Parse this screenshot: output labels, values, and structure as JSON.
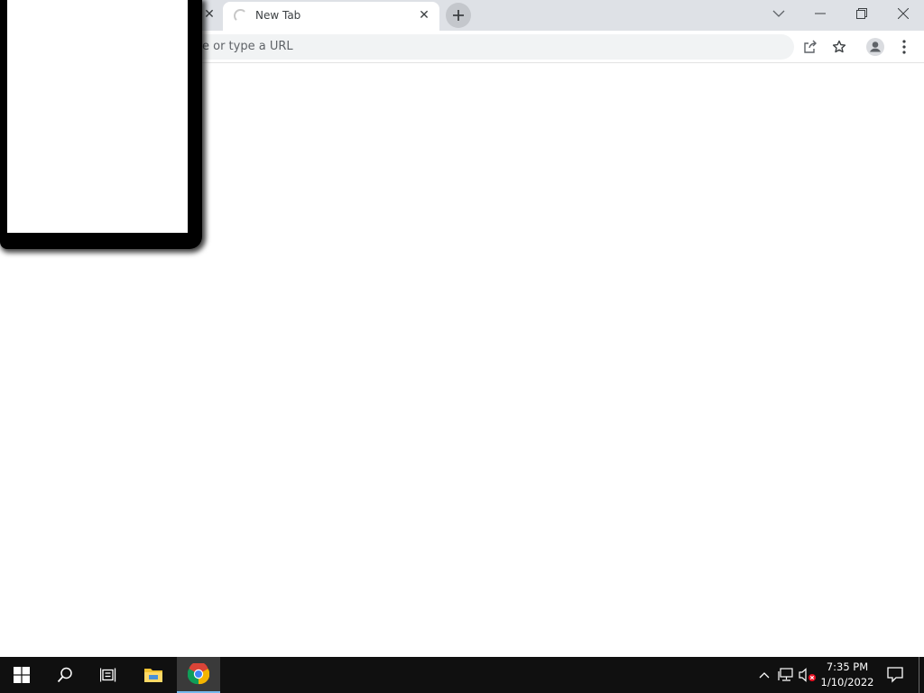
{
  "browser": {
    "tab": {
      "title": "New Tab"
    },
    "omnibox": {
      "placeholder_visible": "e or type a URL"
    }
  },
  "taskbar": {
    "clock": {
      "time": "7:35 PM",
      "date": "1/10/2022"
    },
    "apps": [
      "start",
      "search",
      "task-view",
      "file-explorer",
      "chrome"
    ]
  },
  "colors": {
    "tabstrip_bg": "#dee1e6",
    "taskbar_bg": "#101010",
    "active_indicator": "#76b9ed"
  }
}
